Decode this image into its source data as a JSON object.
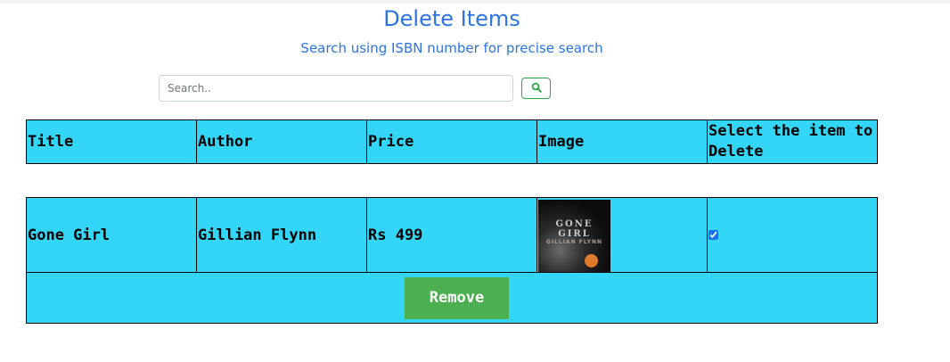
{
  "page": {
    "title": "Delete Items",
    "subtitle": "Search using ISBN number for precise search"
  },
  "search": {
    "placeholder": "Search..",
    "value": "",
    "button_icon": "search-icon"
  },
  "table": {
    "columns": [
      "Title",
      "Author",
      "Price",
      "Image",
      "Select the item to Delete"
    ],
    "rows": [
      {
        "title": "Gone Girl",
        "author": "Gillian Flynn",
        "price": "Rs 499",
        "image": {
          "line1": "GONE",
          "line2": "GIRL",
          "line3": "GILLIAN FLYNN"
        },
        "selected": true
      }
    ]
  },
  "actions": {
    "remove_label": "Remove"
  },
  "colors": {
    "accent": "#2b74e2",
    "table_bg": "#33d6f7",
    "remove_button": "#4caf50",
    "search_button_border": "#28a745"
  }
}
